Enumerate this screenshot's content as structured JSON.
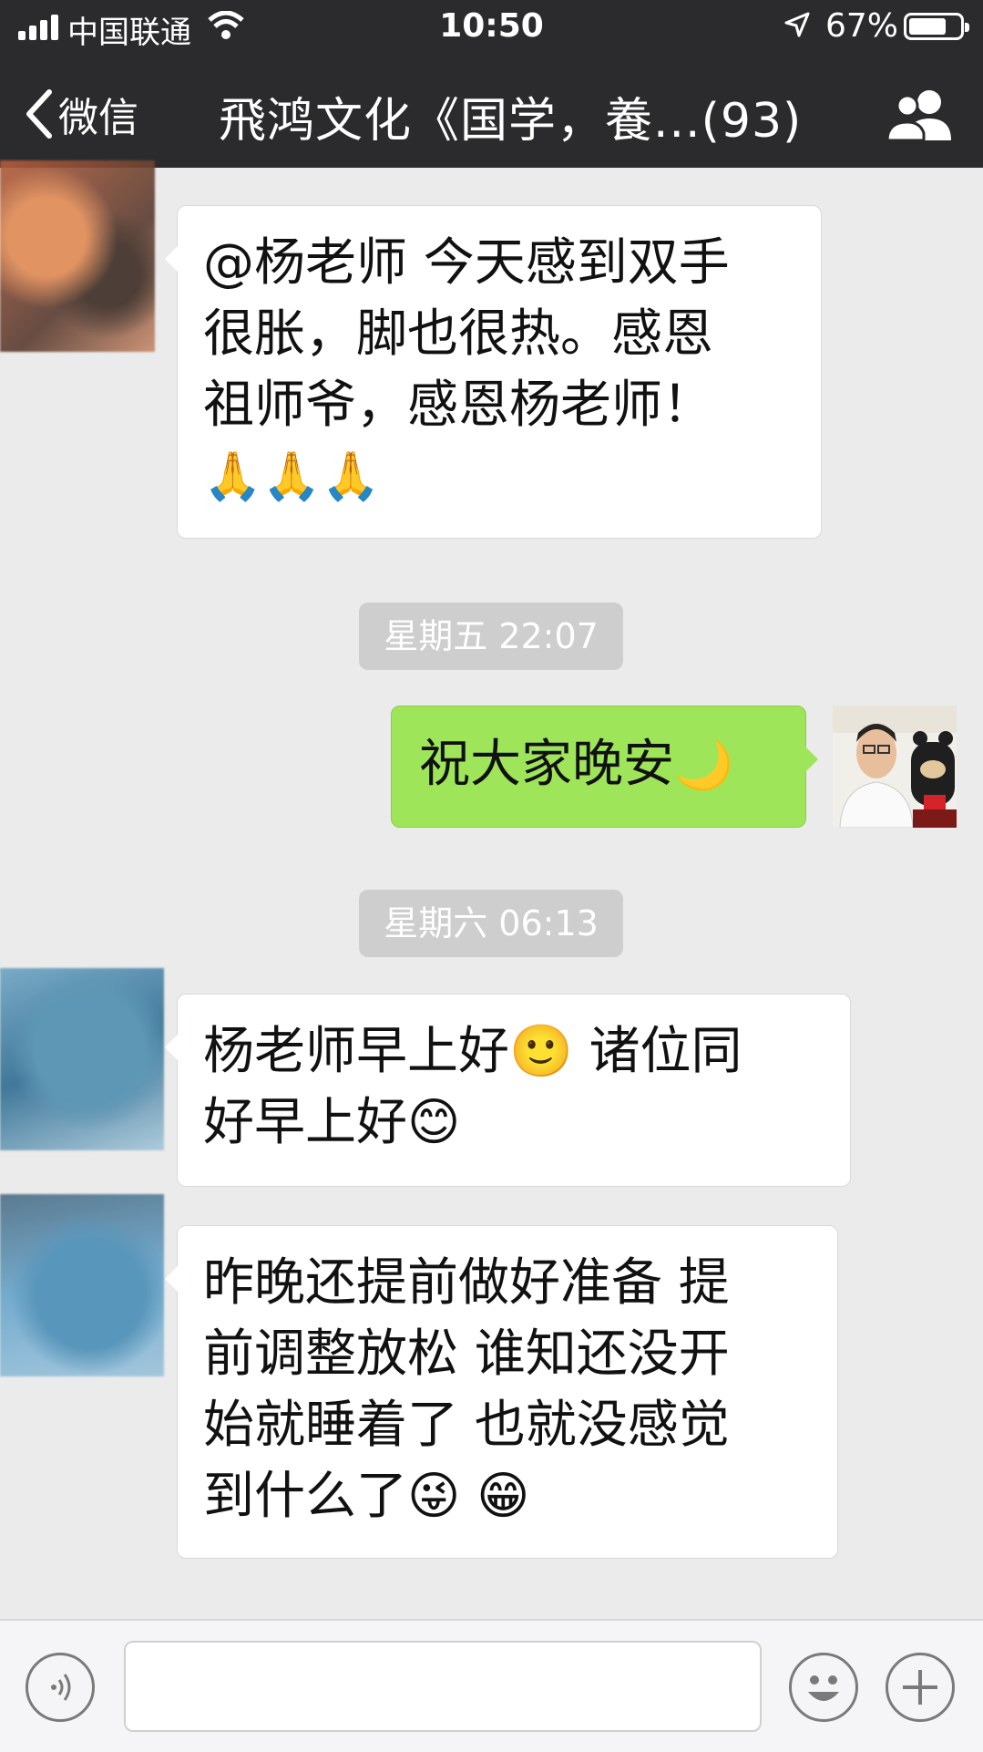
{
  "status_bar": {
    "carrier": "中国联通",
    "time": "10:50",
    "battery_percent": "67%",
    "battery_level": 0.67
  },
  "nav": {
    "back_label": "微信",
    "title": "飛鸿文化《国学，養...(93)"
  },
  "messages": [
    {
      "type": "incoming",
      "text_lines": [
        "@杨老师 今天感到双手",
        "很胀，脚也很热。感恩",
        "祖师爷，感恩杨老师！"
      ],
      "emojis": "🙏🙏🙏"
    },
    {
      "type": "timestamp",
      "text": "星期五 22:07"
    },
    {
      "type": "outgoing",
      "text": "祝大家晚安",
      "emoji": "🌙"
    },
    {
      "type": "timestamp",
      "text": "星期六 06:13"
    },
    {
      "type": "incoming",
      "text_lines": [
        "杨老师早上好🙂  诸位同",
        "好早上好😊"
      ]
    },
    {
      "type": "incoming",
      "text_lines": [
        "昨晚还提前做好准备 提",
        "前调整放松  谁知还没开",
        "始就睡着了 也就没感觉",
        "到什么了😜 😁"
      ]
    }
  ],
  "icons": {
    "back": "chevron-left-icon",
    "contacts": "group-icon",
    "voice": "voice-icon",
    "emoji": "emoji-icon",
    "plus": "plus-icon"
  }
}
